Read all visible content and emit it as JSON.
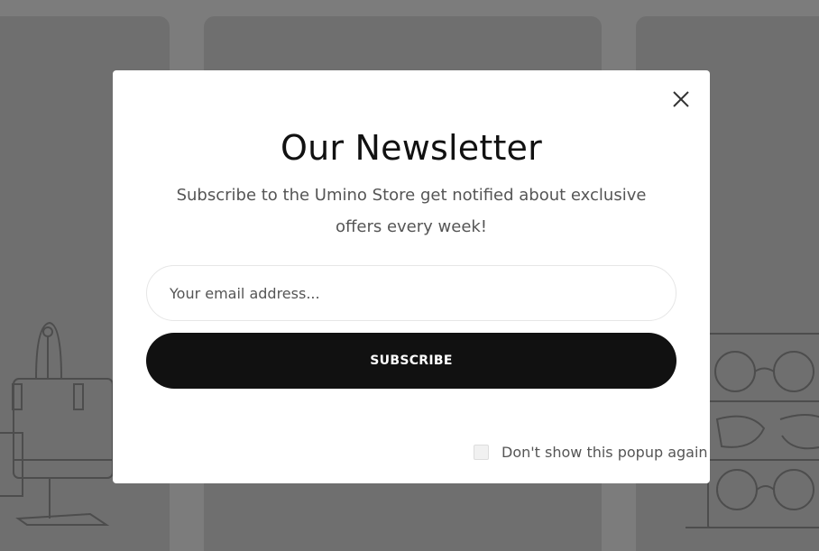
{
  "newsletter_popup": {
    "title": "Our Newsletter",
    "subtitle": "Subscribe to the Umino Store get notified about exclusive offers every week!",
    "email_placeholder": "Your email address...",
    "email_value": "",
    "subscribe_label": "SUBSCRIBE",
    "dont_show_label": "Don't show this popup again",
    "dont_show_checked": false,
    "close_icon": "close-icon"
  },
  "colors": {
    "overlay": "#7c7c7c",
    "button_bg": "#111111",
    "button_text": "#ffffff",
    "modal_bg": "#ffffff"
  }
}
